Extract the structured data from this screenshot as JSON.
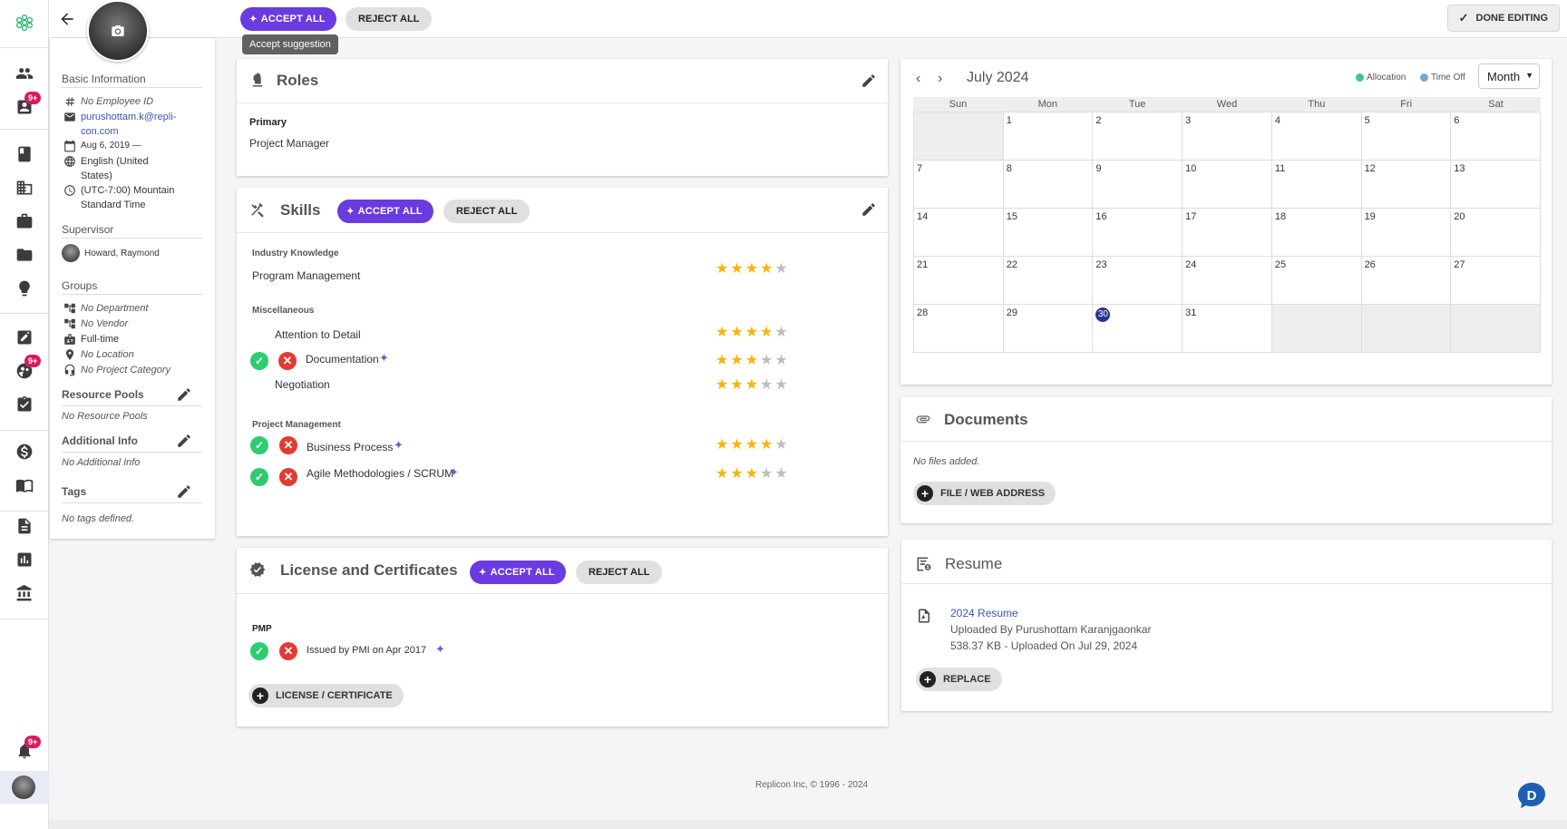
{
  "topbar": {
    "accept_all": "ACCEPT ALL",
    "reject_all": "REJECT ALL",
    "tooltip": "Accept suggestion",
    "done_editing": "DONE EDITING"
  },
  "rail": {
    "badges": [
      "9+",
      "9+",
      "9+"
    ]
  },
  "profile": {
    "basic_info": "Basic Information",
    "employee_id": "No Employee ID",
    "email": "purushottam.k@repli-con.com",
    "email_line1": "purushottam.k@repli-",
    "email_line2": "con.com",
    "start_date": "Aug 6, 2019 —",
    "language_line1": "English (United",
    "language_line2": "States)",
    "timezone_line1": "(UTC-7:00) Mountain",
    "timezone_line2": "Standard Time",
    "supervisor_h": "Supervisor",
    "supervisor": "Howard, Raymond",
    "groups_h": "Groups",
    "department": "No Department",
    "vendor": "No Vendor",
    "employment": "Full-time",
    "location": "No Location",
    "project_category": "No Project Category",
    "resource_pools_h": "Resource Pools",
    "resource_pools": "No Resource Pools",
    "additional_info_h": "Additional Info",
    "additional_info": "No Additional Info",
    "tags_h": "Tags",
    "tags": "No tags defined."
  },
  "roles": {
    "title": "Roles",
    "primary_h": "Primary",
    "primary": "Project Manager"
  },
  "skills": {
    "title": "Skills",
    "accept_all": "ACCEPT ALL",
    "reject_all": "REJECT ALL",
    "groups": [
      {
        "name": "Industry Knowledge",
        "items": [
          {
            "label": "Program Management",
            "rating": 4
          }
        ]
      },
      {
        "name": "Miscellaneous",
        "items": [
          {
            "label": "Attention to Detail",
            "rating": 4
          },
          {
            "label": "Documentation",
            "rating": 3,
            "suggested": true
          },
          {
            "label": "Negotiation",
            "rating": 3
          }
        ]
      },
      {
        "name": "Project Management",
        "items": [
          {
            "label": "Business Process",
            "rating": 4,
            "suggested": true
          },
          {
            "label": "Agile Methodologies / SCRUM",
            "rating": 3,
            "suggested": true
          }
        ]
      }
    ]
  },
  "license": {
    "title": "License and Certificates",
    "accept_all": "ACCEPT ALL",
    "reject_all": "REJECT ALL",
    "cert_name": "PMP",
    "cert_issue": "Issued by PMI on Apr 2017",
    "add_button": "LICENSE / CERTIFICATE"
  },
  "calendar": {
    "month_label": "July 2024",
    "view": "Month",
    "legend": [
      {
        "label": "Allocation",
        "color": "#3ec88f"
      },
      {
        "label": "Time Off",
        "color": "#7ba7c9"
      }
    ],
    "weekdays": [
      "Sun",
      "Mon",
      "Tue",
      "Wed",
      "Thu",
      "Fri",
      "Sat"
    ],
    "leading_blank_days": 1,
    "days_in_month": 31,
    "today": 30
  },
  "documents": {
    "title": "Documents",
    "empty": "No files added.",
    "add_button": "FILE / WEB ADDRESS"
  },
  "resume": {
    "title": "Resume",
    "file_name": "2024 Resume",
    "uploaded_by": "Uploaded By Purushottam Karanjgaonkar",
    "meta": "538.37 KB - Uploaded On Jul 29, 2024",
    "replace": "REPLACE"
  },
  "footer": "Replicon Inc, © 1996 - 2024",
  "colors": {
    "accent": "#6a3be0",
    "star": "#f5b50a",
    "accept_green": "#2ecc71",
    "reject_red": "#e53935",
    "today": "#283593"
  }
}
